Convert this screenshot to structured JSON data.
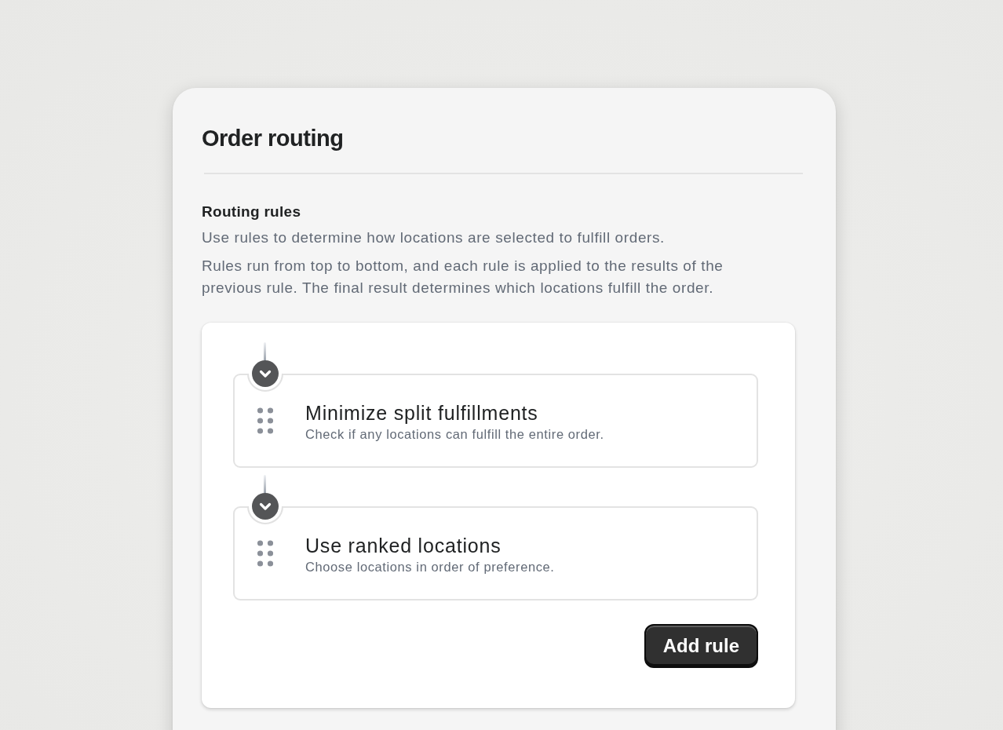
{
  "panel": {
    "title": "Order routing"
  },
  "section": {
    "heading": "Routing rules",
    "paragraphs": [
      "Use rules to determine how locations are selected to fulfill orders.",
      "Rules run from top to bottom, and each rule is applied to the results of the previous rule. The final result determines which locations fulfill the order."
    ]
  },
  "rules": [
    {
      "title": "Minimize split fulfillments",
      "description": "Check if any locations can fulfill the entire order."
    },
    {
      "title": "Use ranked locations",
      "description": "Choose locations in order of preference."
    }
  ],
  "add_button": {
    "label": "Add rule"
  }
}
